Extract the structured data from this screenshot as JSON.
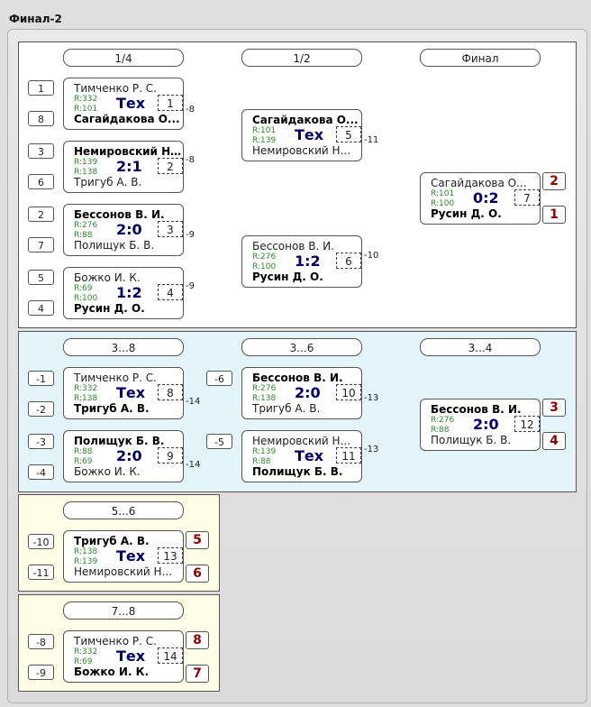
{
  "title": "Финал-2",
  "rounds": {
    "main": [
      "1/4",
      "1/2",
      "Финал"
    ],
    "consolation": [
      "3...8",
      "3...6",
      "3...4"
    ],
    "p56": "5...6",
    "p78": "7...8"
  },
  "matches": [
    {
      "id": "m1",
      "num": "1",
      "p1": "Тимченко Р. С.",
      "p2": "Сагайдакова О...",
      "r1": "R:332",
      "r2": "R:101",
      "score": "Тех",
      "winner": 2
    },
    {
      "id": "m2",
      "num": "2",
      "p1": "Немировский Н...",
      "p2": "Тригуб А. В.",
      "r1": "R:139",
      "r2": "R:138",
      "score": "2:1",
      "winner": 1
    },
    {
      "id": "m3",
      "num": "3",
      "p1": "Бессонов В. И.",
      "p2": "Полищук Б. В.",
      "r1": "R:276",
      "r2": "R:88",
      "score": "2:0",
      "winner": 1
    },
    {
      "id": "m4",
      "num": "4",
      "p1": "Божко И. К.",
      "p2": "Русин Д. О.",
      "r1": "R:69",
      "r2": "R:100",
      "score": "1:2",
      "winner": 2
    },
    {
      "id": "m5",
      "num": "5",
      "p1": "Сагайдакова О...",
      "p2": "Немировский Н...",
      "r1": "R:101",
      "r2": "R:139",
      "score": "Тех",
      "winner": 1
    },
    {
      "id": "m6",
      "num": "6",
      "p1": "Бессонов В. И.",
      "p2": "Русин Д. О.",
      "r1": "R:276",
      "r2": "R:100",
      "score": "1:2",
      "winner": 2
    },
    {
      "id": "m7",
      "num": "7",
      "p1": "Сагайдакова О...",
      "p2": "Русин Д. О.",
      "r1": "R:101",
      "r2": "R:100",
      "score": "0:2",
      "winner": 2
    },
    {
      "id": "m8",
      "num": "8",
      "p1": "Тимченко Р. С.",
      "p2": "Тригуб А. В.",
      "r1": "R:332",
      "r2": "R:138",
      "score": "Тех",
      "winner": 2
    },
    {
      "id": "m9",
      "num": "9",
      "p1": "Полищук Б. В.",
      "p2": "Божко И. К.",
      "r1": "R:88",
      "r2": "R:69",
      "score": "2:0",
      "winner": 1
    },
    {
      "id": "m10",
      "num": "10",
      "p1": "Бессонов В. И.",
      "p2": "Тригуб А. В.",
      "r1": "R:276",
      "r2": "R:138",
      "score": "2:0",
      "winner": 1
    },
    {
      "id": "m11",
      "num": "11",
      "p1": "Немировский Н...",
      "p2": "Полищук Б. В.",
      "r1": "R:139",
      "r2": "R:88",
      "score": "Тех",
      "winner": 2
    },
    {
      "id": "m12",
      "num": "12",
      "p1": "Бессонов В. И.",
      "p2": "Полищук Б. В.",
      "r1": "R:276",
      "r2": "R:88",
      "score": "2:0",
      "winner": 1
    },
    {
      "id": "m13",
      "num": "13",
      "p1": "Тригуб А. В.",
      "p2": "Немировский Н...",
      "r1": "R:138",
      "r2": "R:139",
      "score": "Тех",
      "winner": 1
    },
    {
      "id": "m14",
      "num": "14",
      "p1": "Тимченко Р. С.",
      "p2": "Божко И. К.",
      "r1": "R:332",
      "r2": "R:69",
      "score": "Тех",
      "winner": 2
    }
  ],
  "seeds": {
    "main": [
      "1",
      "8",
      "3",
      "6",
      "2",
      "7",
      "5",
      "4"
    ],
    "consolation": [
      "-1",
      "-2",
      "-3",
      "-4",
      "-6",
      "-5"
    ],
    "p56": [
      "-10",
      "-11"
    ],
    "p78": [
      "-8",
      "-9"
    ]
  },
  "loser_links": {
    "m1": "-8",
    "m2": "-8",
    "m3": "-9",
    "m4": "-9",
    "m5": "-11",
    "m6": "-10",
    "m8": "-14",
    "m9": "-14",
    "m10": "-13",
    "m11": "-13"
  },
  "places": {
    "final": [
      "2",
      "1"
    ],
    "third": [
      "3",
      "4"
    ],
    "fifth": [
      "5",
      "6"
    ],
    "seventh": [
      "8",
      "7"
    ]
  },
  "colors": {
    "score": "#000060",
    "rating": "#2b8a2b",
    "place": "#8b0000",
    "main_panel": "#ffffff",
    "consolation_panel": "#e3f5f8",
    "classification_panel": "#fefee7"
  }
}
